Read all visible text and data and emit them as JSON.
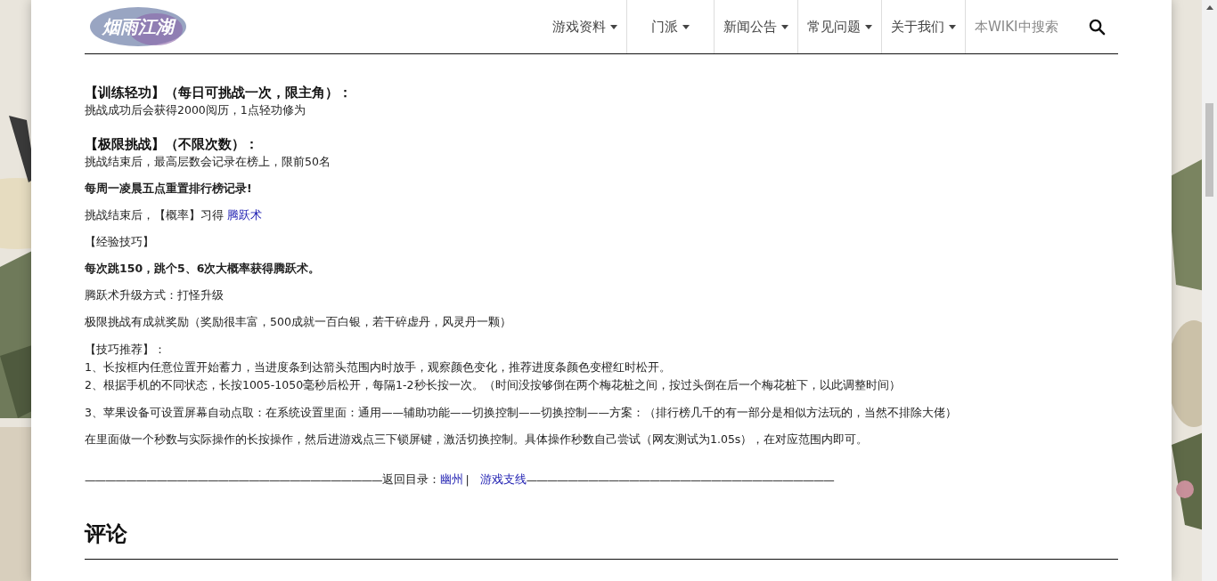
{
  "header": {
    "logo_text": "烟雨江湖",
    "nav": [
      {
        "label": "游戏资料",
        "dropdown": true
      },
      {
        "label": "门派",
        "dropdown": true
      },
      {
        "label": "新闻公告",
        "dropdown": true
      },
      {
        "label": "常见问题",
        "dropdown": true
      },
      {
        "label": "关于我们",
        "dropdown": true
      }
    ],
    "search": {
      "placeholder": "本WIKI中搜索"
    }
  },
  "content": [
    {
      "kind": "heading",
      "text": "【训练轻功】（每日可挑战一次，限主角）："
    },
    {
      "kind": "line",
      "text": "挑战成功后会获得2000阅历，1点轻功修为"
    },
    {
      "kind": "heading",
      "text": "【极限挑战】（不限次数）："
    },
    {
      "kind": "line",
      "text": "挑战结束后，最高层数会记录在榜上，限前50名"
    },
    {
      "kind": "bold",
      "text": "每周一凌晨五点重置排行榜记录!"
    },
    {
      "kind": "link_para",
      "text": "挑战结束后，【概率】习得 ",
      "link": "腾跃术"
    },
    {
      "kind": "para",
      "text": "【经验技巧】"
    },
    {
      "kind": "bold",
      "text": "每次跳150，跳个5、6次大概率获得腾跃术。"
    },
    {
      "kind": "para",
      "text": "腾跃术升级方式：打怪升级"
    },
    {
      "kind": "para",
      "text": "极限挑战有成就奖励（奖励很丰富，500成就一百白银，若干碎虚丹，风灵丹一颗）"
    },
    {
      "kind": "lines",
      "lines": [
        "【技巧推荐】：",
        "1、长按框内任意位置开始蓄力，当进度条到达箭头范围内时放手，观察颜色变化，推荐进度条颜色变橙红时松开。",
        "2、根据手机的不同状态，长按1005-1050毫秒后松开，每隔1-2秒长按一次。（时间没按够倒在两个梅花桩之间，按过头倒在后一个梅花桩下，以此调整时间）"
      ]
    },
    {
      "kind": "para",
      "text": "3、苹果设备可设置屏幕自动点取：在系统设置里面：通用——辅助功能——切换控制——切换控制——方案：（排行榜几千的有一部分是相似方法玩的，当然不排除大佬）"
    },
    {
      "kind": "para",
      "text": "在里面做一个秒数与实际操作的长按操作，然后进游戏点三下锁屏键，激活切换控制。具体操作秒数自己尝试（网友测试为1.05s），在对应范围内即可。"
    }
  ],
  "back_nav": {
    "dashes_left": "—————————————————————————————",
    "label": "返回目录：",
    "links": [
      "幽州",
      "游戏支线"
    ],
    "separator": "|",
    "dashes_right": "——————————————————————————————"
  },
  "comments": {
    "title": "评论"
  }
}
